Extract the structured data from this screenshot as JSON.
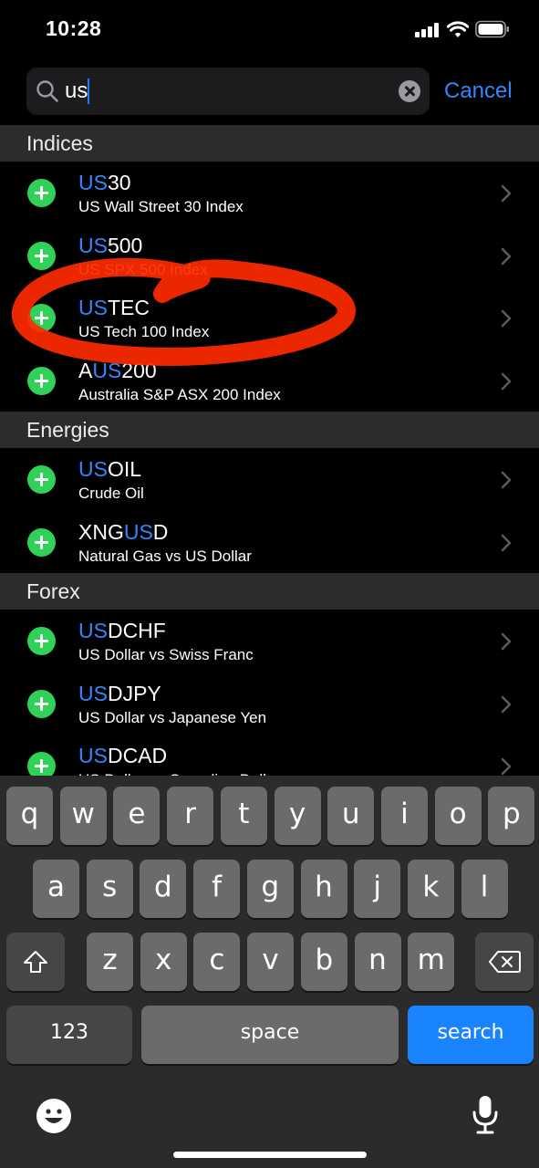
{
  "status_bar": {
    "time": "10:28",
    "icons": [
      "cellular-signal-icon",
      "wifi-icon",
      "battery-icon"
    ]
  },
  "search": {
    "query": "us",
    "cancel_label": "Cancel"
  },
  "colors": {
    "accent": "#2f88ff",
    "add": "#2fd158",
    "annotation": "#ff2a00",
    "keyboard_bg": "#2b2b2b"
  },
  "sections": [
    {
      "title": "Indices",
      "items": [
        {
          "pre": "",
          "hl": "US",
          "post": "30",
          "desc": "US Wall Street 30 Index"
        },
        {
          "pre": "",
          "hl": "US",
          "post": "500",
          "desc": "US SPX 500 Index"
        },
        {
          "pre": "",
          "hl": "US",
          "post": "TEC",
          "desc": "US Tech 100 Index"
        },
        {
          "pre": "A",
          "hl": "US",
          "post": "200",
          "desc": "Australia S&P ASX 200 Index"
        }
      ]
    },
    {
      "title": "Energies",
      "items": [
        {
          "pre": "",
          "hl": "US",
          "post": "OIL",
          "desc": "Crude Oil"
        },
        {
          "pre": "XNG",
          "hl": "US",
          "post": "D",
          "desc": "Natural Gas vs US Dollar"
        }
      ]
    },
    {
      "title": "Forex",
      "items": [
        {
          "pre": "",
          "hl": "US",
          "post": "DCHF",
          "desc": "US Dollar vs Swiss Franc"
        },
        {
          "pre": "",
          "hl": "US",
          "post": "DJPY",
          "desc": "US Dollar vs Japanese Yen"
        },
        {
          "pre": "",
          "hl": "US",
          "post": "DCAD",
          "desc": "US Dollar vs Canadian Dollar"
        }
      ]
    }
  ],
  "keyboard": {
    "row1": [
      "q",
      "w",
      "e",
      "r",
      "t",
      "y",
      "u",
      "i",
      "o",
      "p"
    ],
    "row2": [
      "a",
      "s",
      "d",
      "f",
      "g",
      "h",
      "j",
      "k",
      "l"
    ],
    "row3": [
      "z",
      "x",
      "c",
      "v",
      "b",
      "n",
      "m"
    ],
    "numbers_label": "123",
    "space_label": "space",
    "search_label": "search"
  }
}
